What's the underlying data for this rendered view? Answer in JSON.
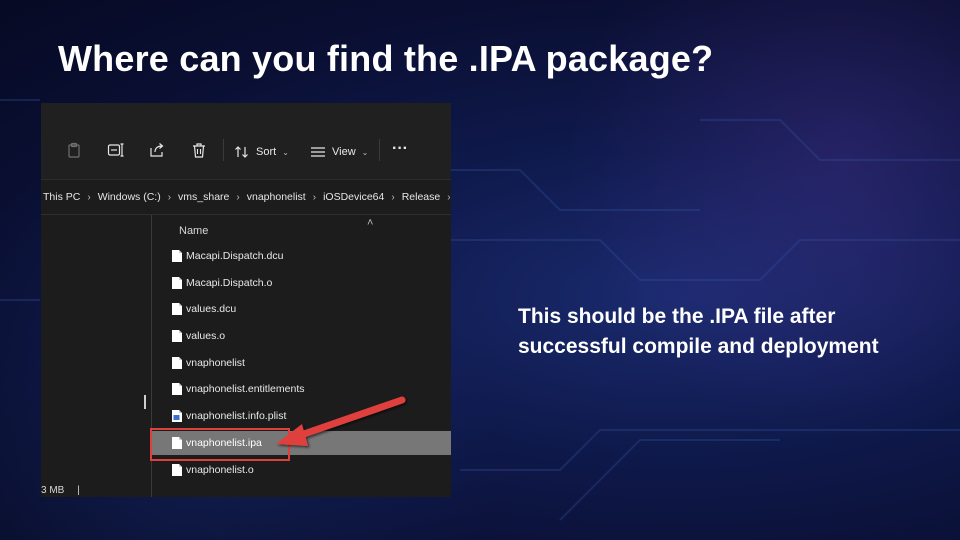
{
  "slide": {
    "title": "Where can you find the .IPA package?",
    "caption_line1": "This should be the .IPA file after",
    "caption_line2": "successful compile and deployment"
  },
  "explorer": {
    "toolbar": {
      "icons": [
        "paste-icon",
        "rename-icon",
        "share-icon",
        "delete-icon"
      ],
      "sort_label": "Sort",
      "view_label": "View",
      "more_label": "···"
    },
    "breadcrumb": [
      "This PC",
      "Windows (C:)",
      "vms_share",
      "vnaphonelist",
      "iOSDevice64",
      "Release"
    ],
    "column_header": "Name",
    "files": [
      {
        "name": "Macapi.Dispatch.dcu",
        "icon": "file-icon"
      },
      {
        "name": "Macapi.Dispatch.o",
        "icon": "file-icon"
      },
      {
        "name": "values.dcu",
        "icon": "file-icon"
      },
      {
        "name": "values.o",
        "icon": "file-icon"
      },
      {
        "name": "vnaphonelist",
        "icon": "file-icon"
      },
      {
        "name": "vnaphonelist.entitlements",
        "icon": "file-icon"
      },
      {
        "name": "vnaphonelist.info.plist",
        "icon": "plist-icon"
      },
      {
        "name": "vnaphonelist.ipa",
        "icon": "file-icon",
        "selected": true
      },
      {
        "name": "vnaphonelist.o",
        "icon": "file-icon"
      }
    ],
    "status_text": "3 MB"
  },
  "colors": {
    "annotation_red": "#e0403c",
    "selected_row": "#777777"
  }
}
